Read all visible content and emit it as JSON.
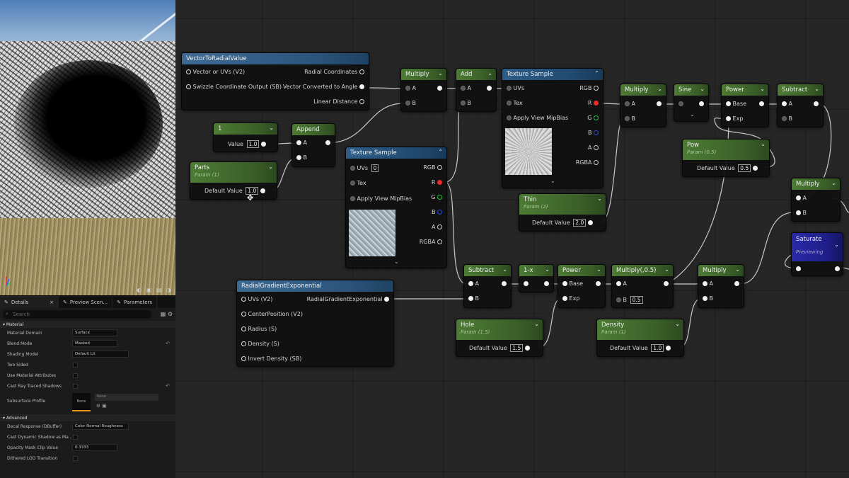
{
  "viewport": {
    "axis_label": "",
    "toolbar_glyphs": "◐ ▣ ▤ ◑"
  },
  "details_panel": {
    "tabs": [
      {
        "label": "Details",
        "close": "×"
      },
      {
        "label": "Preview Scen..."
      },
      {
        "label": "Parameters"
      }
    ],
    "search_placeholder": "Search",
    "sections": {
      "material": "Material",
      "advanced": "Advanced"
    },
    "properties": [
      {
        "label": "Material Domain",
        "value": "Surface"
      },
      {
        "label": "Blend Mode",
        "value": "Masked"
      },
      {
        "label": "Shading Model",
        "value": "Default Lit"
      },
      {
        "label": "Two Sided"
      },
      {
        "label": "Use Material Attributes"
      },
      {
        "label": "Cast Ray Traced Shadows"
      }
    ],
    "subsurface": {
      "label": "Subsurface Profile",
      "swatch": "None",
      "dropdown": "None"
    },
    "advanced_props": [
      {
        "label": "Decal Response (DBuffer)",
        "value": "Color Normal Roughness"
      },
      {
        "label": "Cast Dynamic Shadow as Ma..."
      },
      {
        "label": "Opacity Mask Clip Value",
        "value": "0.3333"
      },
      {
        "label": "Dithered LOD Transition"
      }
    ]
  },
  "graph": {
    "vector_to_radial": {
      "title": "VectorToRadialValue",
      "in1": "Vector or UVs (V2)",
      "in2": "Swizzle Coordinate Output (SB)",
      "out1": "Radial Coordinates",
      "out2": "Vector Converted to Angle",
      "out3": "Linear Distance"
    },
    "const1": {
      "title": "1",
      "pin": "Value",
      "value": "1.0"
    },
    "append": {
      "title": "Append",
      "a": "A",
      "b": "B"
    },
    "parts": {
      "title": "Parts",
      "sub": "Param (1)",
      "pin": "Default Value",
      "value": "1.0"
    },
    "multiply1": {
      "title": "Multiply",
      "a": "A",
      "b": "B"
    },
    "add": {
      "title": "Add",
      "a": "A",
      "b": "B"
    },
    "tex_sample1": {
      "title": "Texture Sample",
      "uvs": "UVs",
      "tex": "Tex",
      "mip": "Apply View MipBias",
      "rgb": "RGB",
      "r": "R",
      "g": "G",
      "b": "B",
      "a": "A",
      "rgba": "RGBA"
    },
    "tex_sample2": {
      "title": "Texture Sample",
      "uvs": "UVs",
      "uv_value": "0",
      "tex": "Tex",
      "mip": "Apply View MipBias",
      "rgb": "RGB",
      "r": "R",
      "g": "G",
      "b": "B",
      "a": "A",
      "rgba": "RGBA"
    },
    "thin": {
      "title": "Thin",
      "sub": "Param (2)",
      "pin": "Default Value",
      "value": "2.0"
    },
    "multiply2": {
      "title": "Multiply",
      "a": "A",
      "b": "B"
    },
    "sine": {
      "title": "Sine"
    },
    "power1": {
      "title": "Power",
      "base": "Base",
      "exp": "Exp"
    },
    "subtract1": {
      "title": "Subtract",
      "a": "A",
      "b": "B"
    },
    "pow": {
      "title": "Pow",
      "sub": "Param (0.5)",
      "pin": "Default Value",
      "value": "0.5"
    },
    "multiply3": {
      "title": "Multiply",
      "a": "A",
      "b": "B"
    },
    "saturate": {
      "title": "Saturate",
      "sub": "Previewing"
    },
    "radial_gradient": {
      "title": "RadialGradientExponential",
      "in1": "UVs (V2)",
      "in2": "CenterPosition (V2)",
      "in3": "Radius (S)",
      "in4": "Density (S)",
      "in5": "Invert Density (SB)",
      "out": "RadialGradientExponential"
    },
    "subtract2": {
      "title": "Subtract",
      "a": "A",
      "b": "B"
    },
    "one_minus": {
      "title": "1-x"
    },
    "power2": {
      "title": "Power",
      "base": "Base",
      "exp": "Exp"
    },
    "multiply_half": {
      "title": "Multiply(,0.5)",
      "a": "A",
      "b": "B",
      "b_value": "0.5"
    },
    "multiply4": {
      "title": "Multiply",
      "a": "A",
      "b": "B"
    },
    "hole": {
      "title": "Hole",
      "sub": "Param (1.5)",
      "pin": "Default Value",
      "value": "1.5"
    },
    "density": {
      "title": "Density",
      "sub": "Param (1)",
      "pin": "Default Value",
      "value": "1.0"
    }
  },
  "colors": {
    "param_header": "#4d7c34",
    "texture_header": "#2e5d88",
    "preview_header": "#2a2aa8",
    "red_pin": "#e82a2a",
    "green_pin": "#27c43a",
    "blue_pin": "#2b46d9",
    "accent_orange": "#e89a1c"
  }
}
